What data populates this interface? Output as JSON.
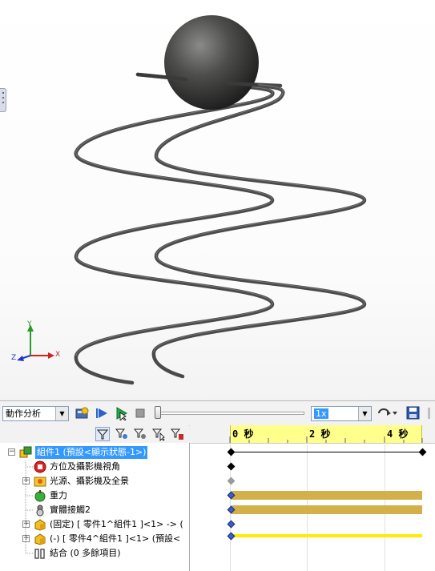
{
  "colors": {
    "accent": "#3399ff",
    "bar": "#d4b04a",
    "thin_bar": "#ffec00",
    "ruler": "#ffff8c"
  },
  "triad": {
    "x": "X",
    "y": "Y",
    "z": "Z"
  },
  "toolbar": {
    "study_type": "動作分析",
    "speed": "1x",
    "icons": [
      "calculate-icon",
      "play-from-start-icon",
      "play-icon",
      "stop-icon",
      "playback-mode-icon",
      "save-animation-icon"
    ]
  },
  "filters": {
    "icons": [
      "filter-animated-icon",
      "filter-driving-icon",
      "filter-selected-icon",
      "filter-results-icon",
      "filter-all-icon"
    ]
  },
  "tree": [
    {
      "label": "組件1 (預設<顯示狀態-1>)",
      "icon": "assembly-icon",
      "selected": true
    },
    {
      "label": "方位及攝影機視角",
      "icon": "orientation-camera-icon"
    },
    {
      "label": "光源、攝影機及全景",
      "icon": "lights-camera-scene-icon"
    },
    {
      "label": "重力",
      "icon": "gravity-icon"
    },
    {
      "label": "實體接觸2",
      "icon": "contact-icon"
    },
    {
      "label": "(固定) [ 零件1^組件1 ]<1> -> (",
      "icon": "part-icon"
    },
    {
      "label": "(-) [ 零件4^組件1 ]<1> (預設<",
      "icon": "part-icon"
    },
    {
      "label": "結合 (0 多餘項目)",
      "icon": "mates-icon"
    }
  ],
  "timeline": {
    "ticks": [
      "0 秒",
      "2 秒",
      "4 秒"
    ]
  }
}
